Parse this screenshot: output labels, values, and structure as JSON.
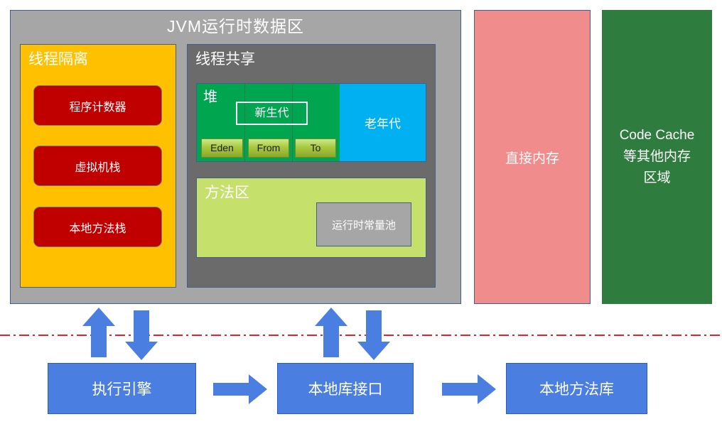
{
  "diagram": {
    "title": "JVM运行时数据区",
    "colors": {
      "outer_panel": "#a6a6a6",
      "thread_isolated": "#ffc000",
      "thread_shared": "#6b6b6b",
      "red_box": "#c00000",
      "young_gen": "#00a550",
      "old_gen": "#00b0f0",
      "survivor": "#a9c93f",
      "method_area": "#c5e06b",
      "constant_pool": "#a6a6a6",
      "direct_memory": "#f08c8c",
      "code_cache": "#2e7d3e",
      "bottom_box": "#4a7ee0",
      "arrow": "#4a7ee0",
      "separator": "#e8202a",
      "border": "#41608f"
    },
    "thread_isolated": {
      "title": "线程隔离",
      "items": [
        {
          "label": "程序计数器"
        },
        {
          "label": "虚拟机栈"
        },
        {
          "label": "本地方法栈"
        }
      ]
    },
    "thread_shared": {
      "title": "线程共享",
      "heap": {
        "label": "堆",
        "young_generation": "新生代",
        "survivors": [
          {
            "label": "Eden"
          },
          {
            "label": "From"
          },
          {
            "label": "To"
          }
        ],
        "old_generation": "老年代"
      },
      "method_area": {
        "label": "方法区",
        "constant_pool": "运行时常量池"
      }
    },
    "direct_memory": {
      "label": "直接内存"
    },
    "code_cache": {
      "line1": "Code Cache",
      "line2": "等其他内存",
      "line3": "区域"
    },
    "bottom": {
      "exec_engine": "执行引擎",
      "native_interface": "本地库接口",
      "native_library": "本地方法库"
    }
  }
}
